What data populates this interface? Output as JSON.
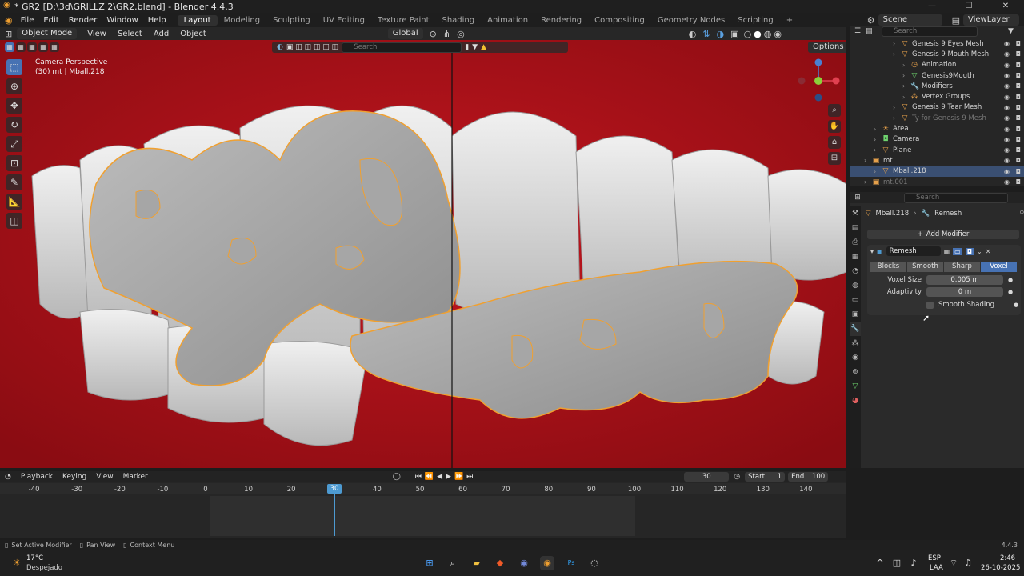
{
  "window": {
    "title": "* GR2 [D:\\3d\\GRILLZ 2\\GR2.blend] - Blender 4.4.3"
  },
  "menu": {
    "items": [
      "File",
      "Edit",
      "Render",
      "Window",
      "Help"
    ]
  },
  "workspaces": [
    "Layout",
    "Modeling",
    "Sculpting",
    "UV Editing",
    "Texture Paint",
    "Shading",
    "Animation",
    "Rendering",
    "Compositing",
    "Geometry Nodes",
    "Scripting"
  ],
  "active_workspace": "Layout",
  "top_right": {
    "scene": "Scene",
    "view_layer": "ViewLayer"
  },
  "viewport_header": {
    "mode": "Object Mode",
    "items": [
      "View",
      "Select",
      "Add",
      "Object"
    ],
    "orientation": "Global",
    "options": "Options",
    "search_placeholder": "Search"
  },
  "viewport": {
    "perspective": "Camera Perspective",
    "object_info": "(30) mt | Mball.218",
    "bg_color": "#a50f18"
  },
  "outliner": {
    "search_placeholder": "Search",
    "rows": [
      {
        "label": "Genesis 9 Eyes Mesh",
        "indent": 3,
        "icon": "mesh"
      },
      {
        "label": "Genesis 9 Mouth Mesh",
        "indent": 3,
        "icon": "mesh"
      },
      {
        "label": "Animation",
        "indent": 4,
        "icon": "anim"
      },
      {
        "label": "Genesis9Mouth",
        "indent": 4,
        "icon": "data"
      },
      {
        "label": "Modifiers",
        "indent": 4,
        "icon": "wrench"
      },
      {
        "label": "Vertex Groups",
        "indent": 4,
        "icon": "group"
      },
      {
        "label": "Genesis 9 Tear Mesh",
        "indent": 3,
        "icon": "mesh"
      },
      {
        "label": "Ty for Genesis 9 Mesh",
        "indent": 3,
        "icon": "mesh",
        "dim": true
      },
      {
        "label": "Area",
        "indent": 1,
        "icon": "light"
      },
      {
        "label": "Camera",
        "indent": 1,
        "icon": "camera"
      },
      {
        "label": "Plane",
        "indent": 1,
        "icon": "mesh"
      },
      {
        "label": "mt",
        "indent": 0,
        "icon": "collection"
      },
      {
        "label": "Mball.218",
        "indent": 1,
        "icon": "mesh",
        "selected": true
      },
      {
        "label": "mt.001",
        "indent": 0,
        "icon": "collection",
        "dim": true
      }
    ]
  },
  "properties": {
    "search_placeholder": "Search",
    "breadcrumb_object": "Mball.218",
    "breadcrumb_modifier": "Remesh",
    "add_modifier": "Add Modifier",
    "modifier_name": "Remesh",
    "modes": [
      "Blocks",
      "Smooth",
      "Sharp",
      "Voxel"
    ],
    "active_mode": "Voxel",
    "voxel_size_label": "Voxel Size",
    "voxel_size": "0.005 m",
    "adaptivity_label": "Adaptivity",
    "adaptivity": "0 m",
    "smooth_shading": "Smooth Shading"
  },
  "timeline": {
    "menu": [
      "Playback",
      "Keying",
      "View",
      "Marker"
    ],
    "current_frame": "30",
    "start_label": "Start",
    "start": "1",
    "end_label": "End",
    "end": "100",
    "ticks": [
      "-40",
      "-30",
      "-20",
      "-10",
      "0",
      "10",
      "20",
      "30",
      "40",
      "50",
      "60",
      "70",
      "80",
      "90",
      "100",
      "110",
      "120",
      "130",
      "140"
    ]
  },
  "statusbar": {
    "items": [
      "Set Active Modifier",
      "Pan View",
      "Context Menu"
    ],
    "version": "4.4.3"
  },
  "taskbar": {
    "temp": "17°C",
    "weather": "Despejado",
    "lang": "ESP",
    "layout": "LAA",
    "time": "2:46",
    "date": "26-10-2025"
  }
}
